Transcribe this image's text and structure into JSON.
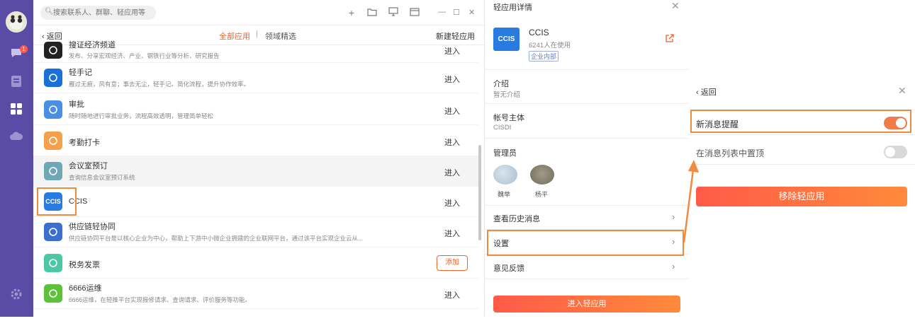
{
  "search": {
    "placeholder": "搜索联系人、群聊、轻应用等"
  },
  "nav": {
    "badge": "1"
  },
  "subbar": {
    "back": "返回",
    "tab_all": "全部应用",
    "tab_sep": "|",
    "tab_field": "领域精选",
    "new_app": "新建轻应用"
  },
  "apps": [
    {
      "name": "搜证经济频道",
      "desc": "发布、分享宏观经济、产业、钢铁行业等分析、研究报告",
      "action": "进入",
      "icon_color": "#222222",
      "icon": "news-icon"
    },
    {
      "name": "轻手记",
      "desc": "雁过无痕，风有意；事去无尘，轻手记。简化流程，提升协作效率。",
      "action": "进入",
      "icon_color": "#1a6fd8",
      "icon": "feather-icon"
    },
    {
      "name": "审批",
      "desc": "随时随地进行审批业务，流程高效透明，管理简单轻松",
      "action": "进入",
      "icon_color": "#4a90e2",
      "icon": "approval-icon"
    },
    {
      "name": "考勤打卡",
      "desc": "",
      "action": "进入",
      "icon_color": "#f5a04a",
      "icon": "location-icon"
    },
    {
      "name": "会议室预订",
      "desc": "查询信息会议室预订系统",
      "action": "进入",
      "icon_color": "#6fa8b5",
      "icon": "meeting-icon"
    },
    {
      "name": "CCIS",
      "desc": "",
      "action": "进入",
      "icon_color": "#2a7be0",
      "icon": "ccis-logo"
    },
    {
      "name": "供应链轻协同",
      "desc": "供应链协同平台是以核心企业为中心，帮助上下游中小微企业拥建的企业联网平台，通过该平台实现企业云从...",
      "action": "进入",
      "icon_color": "#3a6fd0",
      "icon": "triangle-icon"
    },
    {
      "name": "税务发票",
      "desc": "",
      "action": "添加",
      "icon_color": "#4cc7a4",
      "icon": "invoice-icon"
    },
    {
      "name": "6666运维",
      "desc": "6666运维，在轻推平台实现报修请求、查询请求、评价服务等功能。",
      "action": "进入",
      "icon_color": "#5cc23a",
      "icon": "phone-icon"
    }
  ],
  "detail": {
    "title": "轻应用详情",
    "logo_text": "CCIS",
    "name": "CCIS",
    "users": "6241人在使用",
    "tag": "企业内部",
    "intro_label": "介绍",
    "intro_value": "暂无介绍",
    "owner_label": "帐号主体",
    "owner_value": "CISDI",
    "admin_label": "管理员",
    "admins": [
      "魏举",
      "杨平"
    ],
    "history": "查看历史消息",
    "settings": "设置",
    "feedback": "意见反馈",
    "enter_button": "进入轻应用"
  },
  "settings_panel": {
    "back": "返回",
    "new_msg": "新消息提醒",
    "new_msg_on": true,
    "pin_top": "在消息列表中置顶",
    "pin_top_on": false,
    "remove_button": "移除轻应用"
  },
  "colors": {
    "accent": "#f5622b",
    "rail": "#5a4ba6",
    "highlight": "#f08a3c"
  }
}
